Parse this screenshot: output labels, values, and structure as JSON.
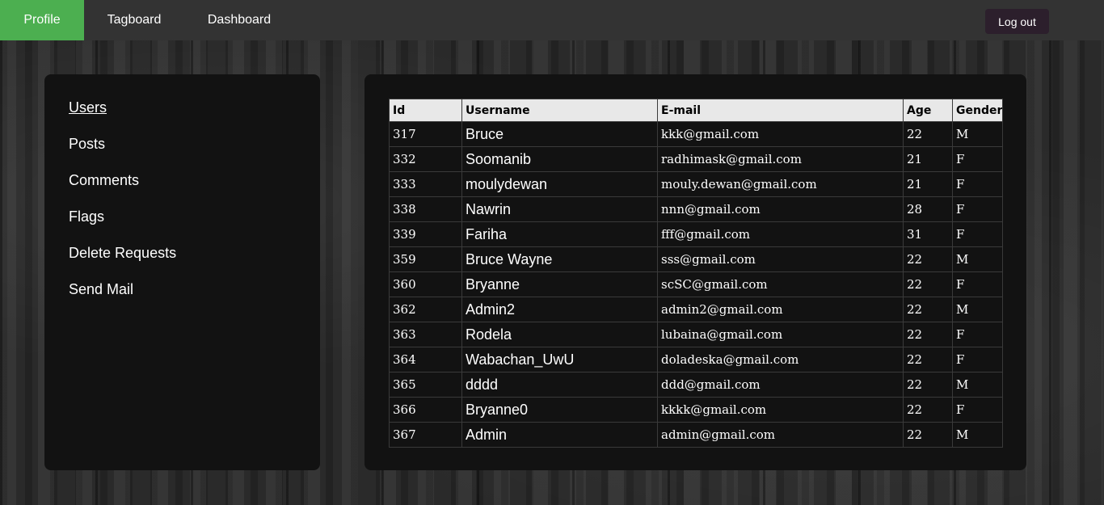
{
  "nav": {
    "profile": "Profile",
    "tagboard": "Tagboard",
    "dashboard": "Dashboard",
    "logout": "Log out",
    "active_color": "#4caf50"
  },
  "sidebar": {
    "items": [
      {
        "label": "Users",
        "active": true
      },
      {
        "label": "Posts"
      },
      {
        "label": "Comments"
      },
      {
        "label": "Flags"
      },
      {
        "label": "Delete Requests"
      },
      {
        "label": "Send Mail"
      }
    ]
  },
  "table": {
    "headers": [
      "Id",
      "Username",
      "E-mail",
      "Age",
      "Gender"
    ],
    "rows": [
      [
        "317",
        "Bruce",
        "kkk@gmail.com",
        "22",
        "M"
      ],
      [
        "332",
        "Soomanib",
        "radhimask@gmail.com",
        "21",
        "F"
      ],
      [
        "333",
        "moulydewan",
        "mouly.dewan@gmail.com",
        "21",
        "F"
      ],
      [
        "338",
        "Nawrin",
        "nnn@gmail.com",
        "28",
        "F"
      ],
      [
        "339",
        "Fariha",
        "fff@gmail.com",
        "31",
        "F"
      ],
      [
        "359",
        "Bruce Wayne",
        "sss@gmail.com",
        "22",
        "M"
      ],
      [
        "360",
        "Bryanne",
        "scSC@gmail.com",
        "22",
        "F"
      ],
      [
        "362",
        "Admin2",
        "admin2@gmail.com",
        "22",
        "M"
      ],
      [
        "363",
        "Rodela",
        "lubaina@gmail.com",
        "22",
        "F"
      ],
      [
        "364",
        "Wabachan_UwU",
        "doladeska@gmail.com",
        "22",
        "F"
      ],
      [
        "365",
        "dddd",
        "ddd@gmail.com",
        "22",
        "M"
      ],
      [
        "366",
        "Bryanne0",
        "kkkk@gmail.com",
        "22",
        "F"
      ],
      [
        "367",
        "Admin",
        "admin@gmail.com",
        "22",
        "M"
      ]
    ]
  }
}
